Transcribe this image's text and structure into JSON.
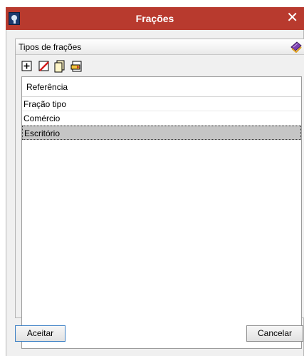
{
  "window": {
    "title": "Frações",
    "close_label": "✕"
  },
  "group": {
    "title": "Tipos de frações"
  },
  "toolbar": {
    "buttons": [
      "add-icon",
      "delete-icon",
      "copy-icon",
      "import-icon"
    ]
  },
  "list": {
    "header": "Referência",
    "rows": [
      {
        "label": "Fração tipo",
        "selected": false
      },
      {
        "label": "Comércio",
        "selected": false
      },
      {
        "label": "Escritório",
        "selected": true
      }
    ]
  },
  "footer": {
    "ok_label": "Aceitar",
    "cancel_label": "Cancelar"
  },
  "colors": {
    "titlebar": "#b83a2e",
    "selection": "#c5c5c5"
  }
}
